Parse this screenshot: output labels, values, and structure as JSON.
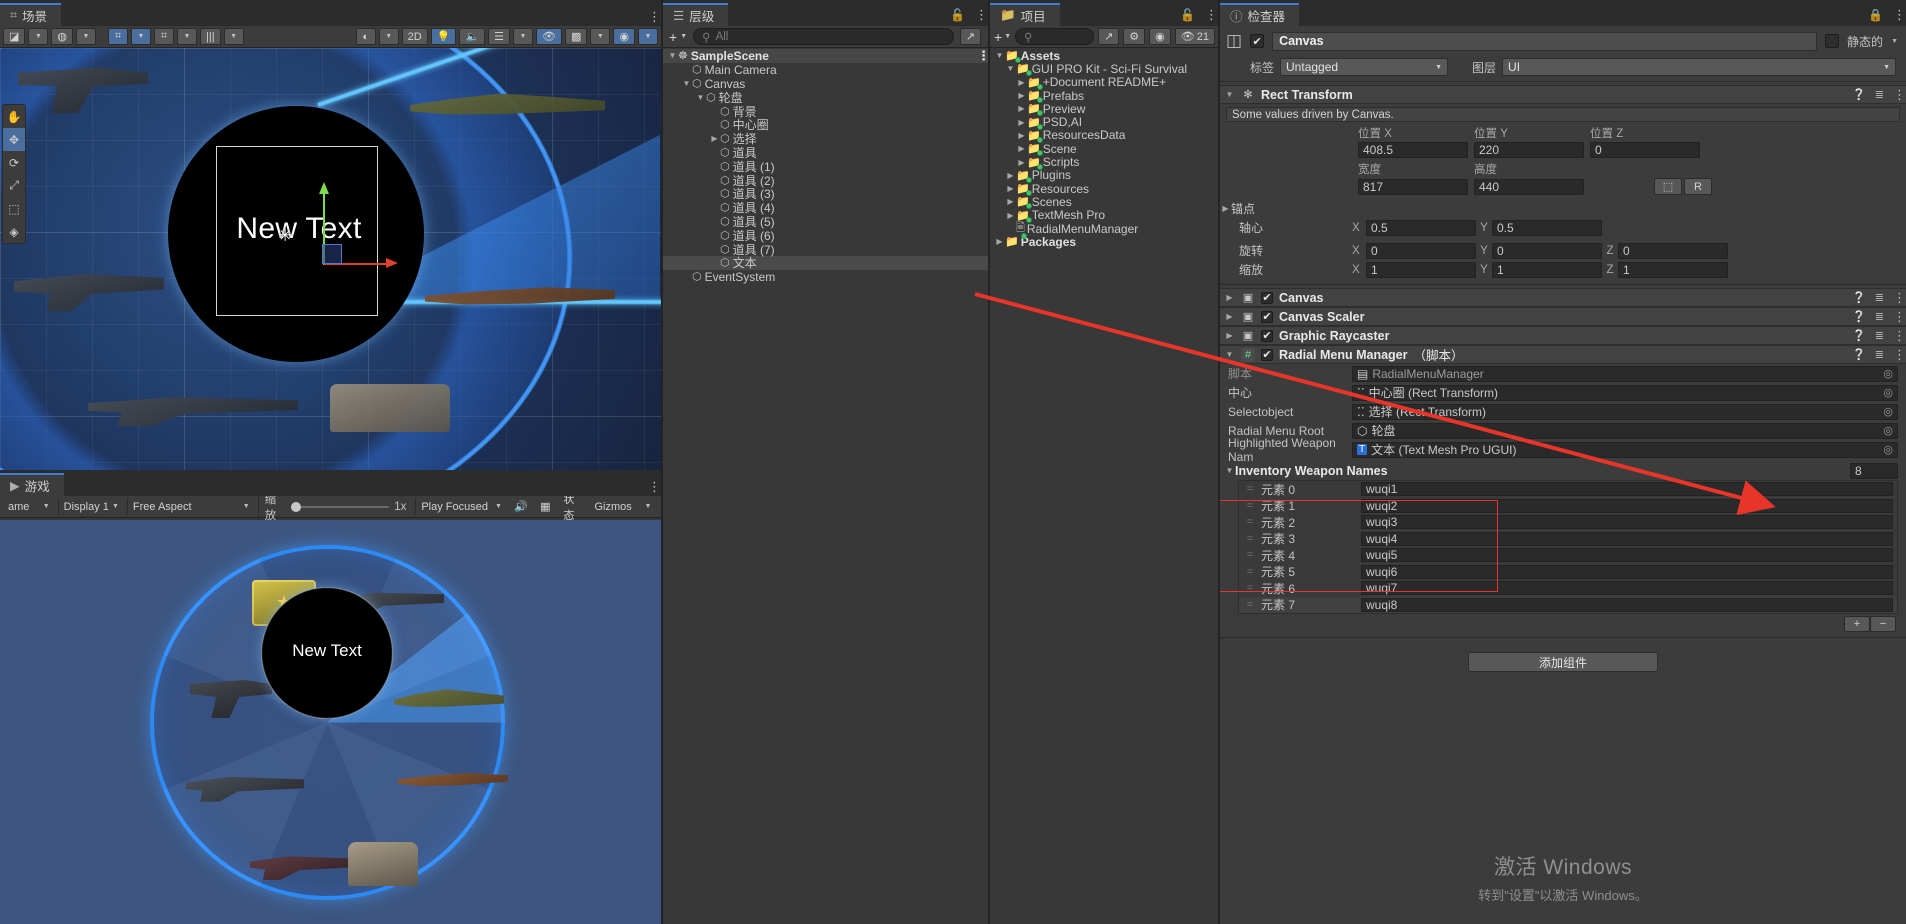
{
  "scene_panel": {
    "tab_label": "场景",
    "toolbar": {
      "shading_label": "",
      "twod_label": "2D",
      "gizmo_count": ""
    },
    "tools": [
      "hand-tool",
      "move-tool",
      "rotate-tool",
      "scale-tool",
      "rect-tool",
      "transform-tool"
    ],
    "center_text": "New Text"
  },
  "game_panel": {
    "tab_label": "游戏",
    "toolbar": {
      "game_dropdown": "ame",
      "display": "Display 1",
      "aspect": "Free Aspect",
      "scale_label": "缩放",
      "scale_value": "1x",
      "play_mode": "Play Focused",
      "stats_label": "状态",
      "gizmos_label": "Gizmos"
    },
    "center_text": "New Text"
  },
  "hierarchy": {
    "tab_label": "层级",
    "search_placeholder": "All",
    "add_label": "+",
    "items": [
      {
        "label": "SampleScene",
        "depth": 0,
        "arrow": "▼",
        "icon": "unity-scene-icon",
        "selected": false,
        "scene": true
      },
      {
        "label": "Main Camera",
        "depth": 1,
        "arrow": "",
        "icon": "cube-icon",
        "selected": false,
        "scene": false
      },
      {
        "label": "Canvas",
        "depth": 1,
        "arrow": "▼",
        "icon": "cube-icon",
        "selected": false,
        "scene": false
      },
      {
        "label": "轮盘",
        "depth": 2,
        "arrow": "▼",
        "icon": "cube-icon",
        "selected": false,
        "scene": false
      },
      {
        "label": "背景",
        "depth": 3,
        "arrow": "",
        "icon": "cube-icon",
        "selected": false,
        "scene": false
      },
      {
        "label": "中心圈",
        "depth": 3,
        "arrow": "",
        "icon": "cube-icon",
        "selected": false,
        "scene": false
      },
      {
        "label": "选择",
        "depth": 3,
        "arrow": "▶",
        "icon": "cube-icon",
        "selected": false,
        "scene": false
      },
      {
        "label": "道具",
        "depth": 3,
        "arrow": "",
        "icon": "cube-icon",
        "selected": false,
        "scene": false
      },
      {
        "label": "道具 (1)",
        "depth": 3,
        "arrow": "",
        "icon": "cube-icon",
        "selected": false,
        "scene": false
      },
      {
        "label": "道具 (2)",
        "depth": 3,
        "arrow": "",
        "icon": "cube-icon",
        "selected": false,
        "scene": false
      },
      {
        "label": "道具 (3)",
        "depth": 3,
        "arrow": "",
        "icon": "cube-icon",
        "selected": false,
        "scene": false
      },
      {
        "label": "道具 (4)",
        "depth": 3,
        "arrow": "",
        "icon": "cube-icon",
        "selected": false,
        "scene": false
      },
      {
        "label": "道具 (5)",
        "depth": 3,
        "arrow": "",
        "icon": "cube-icon",
        "selected": false,
        "scene": false
      },
      {
        "label": "道具 (6)",
        "depth": 3,
        "arrow": "",
        "icon": "cube-icon",
        "selected": false,
        "scene": false
      },
      {
        "label": "道具 (7)",
        "depth": 3,
        "arrow": "",
        "icon": "cube-icon",
        "selected": false,
        "scene": false
      },
      {
        "label": "文本",
        "depth": 3,
        "arrow": "",
        "icon": "cube-icon",
        "selected": true,
        "scene": false
      },
      {
        "label": "EventSystem",
        "depth": 1,
        "arrow": "",
        "icon": "cube-icon",
        "selected": false,
        "scene": false
      }
    ]
  },
  "project": {
    "tab_label": "项目",
    "search_placeholder": "",
    "hidden_count": "21",
    "items": [
      {
        "label": "Assets",
        "depth": 0,
        "arrow": "▼",
        "bold": true,
        "badge": "plus"
      },
      {
        "label": "GUI PRO Kit - Sci-Fi Survival",
        "depth": 1,
        "arrow": "▼",
        "bold": false,
        "badge": "check"
      },
      {
        "label": "+Document README+",
        "depth": 2,
        "arrow": "▶",
        "bold": false,
        "badge": "check"
      },
      {
        "label": "Prefabs",
        "depth": 2,
        "arrow": "▶",
        "bold": false,
        "badge": "check"
      },
      {
        "label": "Preview",
        "depth": 2,
        "arrow": "▶",
        "bold": false,
        "badge": "check"
      },
      {
        "label": "PSD,AI",
        "depth": 2,
        "arrow": "▶",
        "bold": false,
        "badge": "check"
      },
      {
        "label": "ResourcesData",
        "depth": 2,
        "arrow": "▶",
        "bold": false,
        "badge": "check"
      },
      {
        "label": "Scene",
        "depth": 2,
        "arrow": "▶",
        "bold": false,
        "badge": "check"
      },
      {
        "label": "Scripts",
        "depth": 2,
        "arrow": "▶",
        "bold": false,
        "badge": "check"
      },
      {
        "label": "Plugins",
        "depth": 1,
        "arrow": "▶",
        "bold": false,
        "badge": "check"
      },
      {
        "label": "Resources",
        "depth": 1,
        "arrow": "▶",
        "bold": false,
        "badge": "plus"
      },
      {
        "label": "Scenes",
        "depth": 1,
        "arrow": "▶",
        "bold": false,
        "badge": "plus"
      },
      {
        "label": "TextMesh Pro",
        "depth": 1,
        "arrow": "▶",
        "bold": false,
        "badge": "plus"
      },
      {
        "label": "RadialMenuManager",
        "depth": 1,
        "arrow": "",
        "bold": false,
        "badge": "script"
      },
      {
        "label": "Packages",
        "depth": 0,
        "arrow": "▶",
        "bold": true,
        "badge": "none"
      }
    ]
  },
  "inspector": {
    "tab_label": "检查器",
    "object_name": "Canvas",
    "static_label": "静态的",
    "tag_label": "标签",
    "tag_value": "Untagged",
    "layer_label": "图层",
    "layer_value": "UI",
    "rect_transform": {
      "title": "Rect Transform",
      "helpbox": "Some values driven by Canvas.",
      "pos_x_label": "位置 X",
      "pos_x": "408.5",
      "pos_y_label": "位置 Y",
      "pos_y": "220",
      "pos_z_label": "位置 Z",
      "pos_z": "0",
      "width_label": "宽度",
      "width": "817",
      "height_label": "高度",
      "height": "440",
      "anchors_label": "锚点",
      "pivot_label": "轴心",
      "pivot_x": "0.5",
      "pivot_y": "0.5",
      "rotation_label": "旋转",
      "rot_x": "0",
      "rot_y": "0",
      "rot_z": "0",
      "scale_label": "缩放",
      "scale_x": "1",
      "scale_y": "1",
      "scale_z": "1",
      "blueprint_label": "R"
    },
    "components": [
      {
        "title": "Canvas",
        "enabled": true,
        "icon": "canvas-icon"
      },
      {
        "title": "Canvas Scaler",
        "enabled": true,
        "icon": "canvas-scaler-icon"
      },
      {
        "title": "Graphic Raycaster",
        "enabled": true,
        "icon": "graphic-raycaster-icon"
      }
    ],
    "radial_menu_manager": {
      "title": "Radial Menu Manager",
      "suffix": "（脚本）",
      "enabled": true,
      "fields": [
        {
          "label": "脚本",
          "value": "RadialMenuManager",
          "icon": "script-icon",
          "dim": true
        },
        {
          "label": "中心",
          "value": "中心圈 (Rect Transform)",
          "icon": "rect-icon",
          "dim": false
        },
        {
          "label": "Selectobject",
          "value": "选择 (Rect Transform)",
          "icon": "rect-icon",
          "dim": false
        },
        {
          "label": "Radial Menu Root",
          "value": "轮盘",
          "icon": "cube-icon",
          "dim": false
        },
        {
          "label": "Highlighted Weapon Nam",
          "value": "文本 (Text Mesh Pro UGUI)",
          "icon": "tmp-icon",
          "dim": false
        }
      ],
      "array": {
        "title": "Inventory Weapon Names",
        "size": "8",
        "element_prefix": "元素",
        "items": [
          "wuqi1",
          "wuqi2",
          "wuqi3",
          "wuqi4",
          "wuqi5",
          "wuqi6",
          "wuqi7",
          "wuqi8"
        ],
        "add_label": "+",
        "remove_label": "−"
      }
    },
    "add_component_label": "添加组件"
  },
  "watermark": {
    "line1": "激活 Windows",
    "line2": "转到\"设置\"以激活 Windows。"
  },
  "colors": {
    "accent_blue": "#3a7fd5",
    "panel_bg": "#383838",
    "inspector_bg": "#3c3c3c",
    "highlight_red": "#e8352a",
    "selection_gray": "#4a4a4a"
  }
}
